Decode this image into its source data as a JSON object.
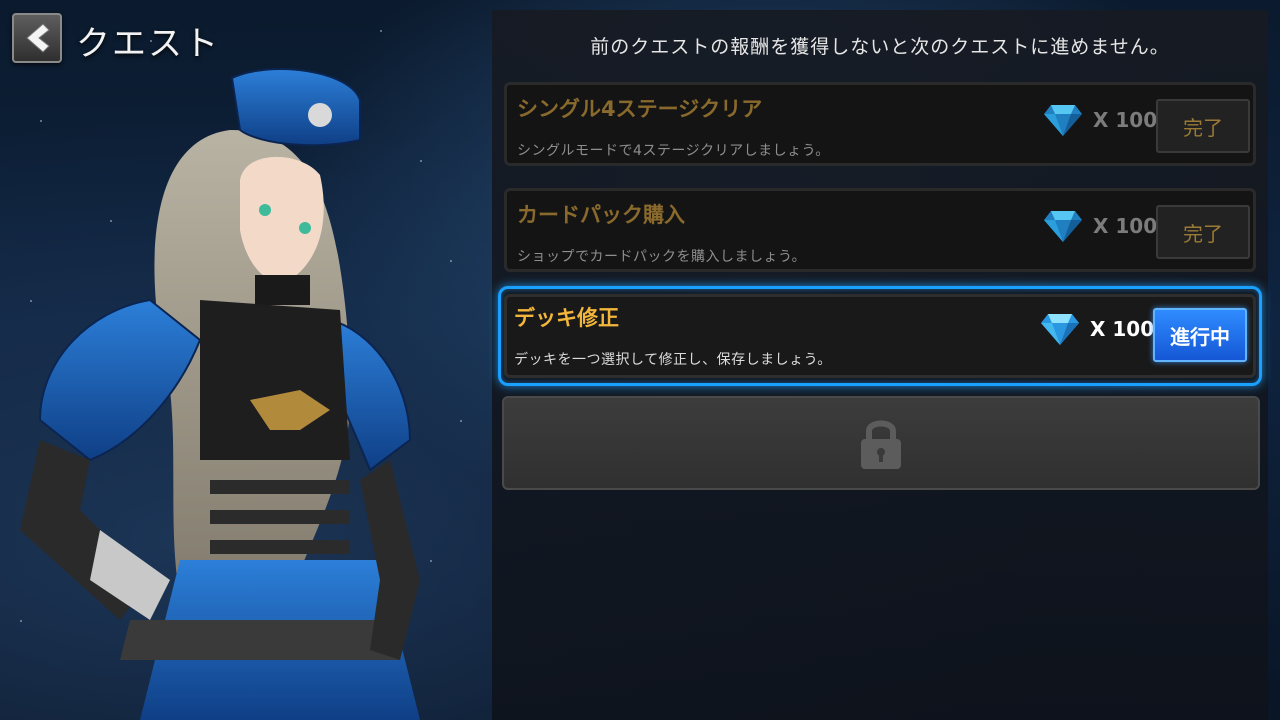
{
  "header": {
    "back_icon": "chevron-left-icon",
    "title": "クエスト"
  },
  "notice": "前のクエストの報酬を獲得しないと次のクエストに進めません。",
  "quests": [
    {
      "title": "シングル4ステージクリア",
      "description": "シングルモードで4ステージクリアしましょう。",
      "reward_icon": "diamond-icon",
      "reward_amount": "X 100",
      "button_label": "完了",
      "state": "complete"
    },
    {
      "title": "カードパック購入",
      "description": "ショップでカードパックを購入しましょう。",
      "reward_icon": "diamond-icon",
      "reward_amount": "X 100",
      "button_label": "完了",
      "state": "complete"
    },
    {
      "title": "デッキ修正",
      "description": "デッキを一つ選択して修正し、保存しましょう。",
      "reward_icon": "diamond-icon",
      "reward_amount": "X 100",
      "button_label": "進行中",
      "state": "in-progress"
    }
  ],
  "locked_slot": {
    "icon": "lock-icon"
  },
  "colors": {
    "active_frame": "#1aa0ff",
    "active_title": "#f3b63a",
    "done_button_text": "#9a7a34",
    "active_button": "#1f6fe8"
  }
}
